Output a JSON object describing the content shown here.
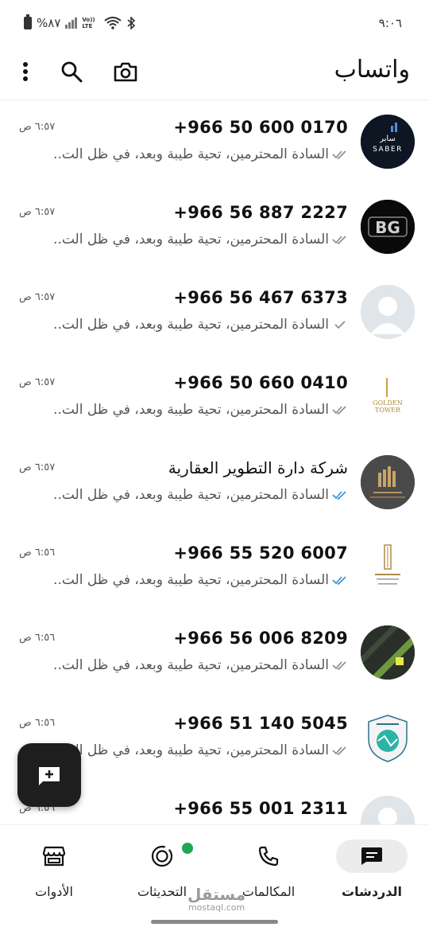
{
  "status_bar": {
    "battery": "%٨٧",
    "time": "٩:٠٦",
    "volte": "Vo)) LTE"
  },
  "app_bar": {
    "title": "واتساب",
    "icons": [
      "camera-icon",
      "search-icon",
      "more-vert-icon"
    ]
  },
  "chats": [
    {
      "name": "+966 50 600 0170",
      "time": "٦:٥٧ ص",
      "preview": "السادة المحترمين، تحية طيبة وبعد، في ظل الت..",
      "ticks": "double-gray",
      "avatar": "saber"
    },
    {
      "name": "+966 56 887 2227",
      "time": "٦:٥٧ ص",
      "preview": "السادة المحترمين، تحية طيبة وبعد، في ظل الت..",
      "ticks": "double-gray",
      "avatar": "bg"
    },
    {
      "name": "+966 56 467 6373",
      "time": "٦:٥٧ ص",
      "preview": "السادة المحترمين، تحية طيبة وبعد، في ظل الت..",
      "ticks": "single-gray",
      "avatar": "default"
    },
    {
      "name": "+966 50 660 0410",
      "time": "٦:٥٧ ص",
      "preview": "السادة المحترمين، تحية طيبة وبعد، في ظل الت..",
      "ticks": "double-gray",
      "avatar": "golden"
    },
    {
      "name": "شركة دارة التطوير العقارية",
      "time": "٦:٥٧ ص",
      "preview": "السادة المحترمين، تحية طيبة وبعد، في ظل الت..",
      "ticks": "double-blue",
      "avatar": "dara"
    },
    {
      "name": "+966 55 520 6007",
      "time": "٦:٥٦ ص",
      "preview": "السادة المحترمين، تحية طيبة وبعد، في ظل الت..",
      "ticks": "double-blue",
      "avatar": "tower"
    },
    {
      "name": "+966 56 006 8209",
      "time": "٦:٥٦ ص",
      "preview": "السادة المحترمين، تحية طيبة وبعد، في ظل الت..",
      "ticks": "double-gray",
      "avatar": "dark-green"
    },
    {
      "name": "+966 51 140 5045",
      "time": "٦:٥٦ ص",
      "preview": "السادة المحترمين، تحية طيبة وبعد، في ظل الت..",
      "ticks": "double-gray",
      "avatar": "shield"
    },
    {
      "name": "+966 55 001 2311",
      "time": "٦:٥٦ ص",
      "preview": "",
      "ticks": "",
      "avatar": "default"
    }
  ],
  "avatar_text": {
    "saber_ar": "سابر",
    "saber_en": "SABER",
    "bg": "BG",
    "golden_1": "GOLDEN",
    "golden_2": "TOWER"
  },
  "bottom_nav": {
    "chats": "الدردشات",
    "calls": "المكالمات",
    "updates": "التحديثات",
    "tools": "الأدوات"
  },
  "watermark": {
    "main": "مستقل",
    "sub": "mostaql.com"
  },
  "colors": {
    "tick_blue": "#2f8fd8",
    "tick_gray": "#8a8a8a",
    "updates_dot": "#1fa855",
    "fab": "#1e1e1e"
  }
}
